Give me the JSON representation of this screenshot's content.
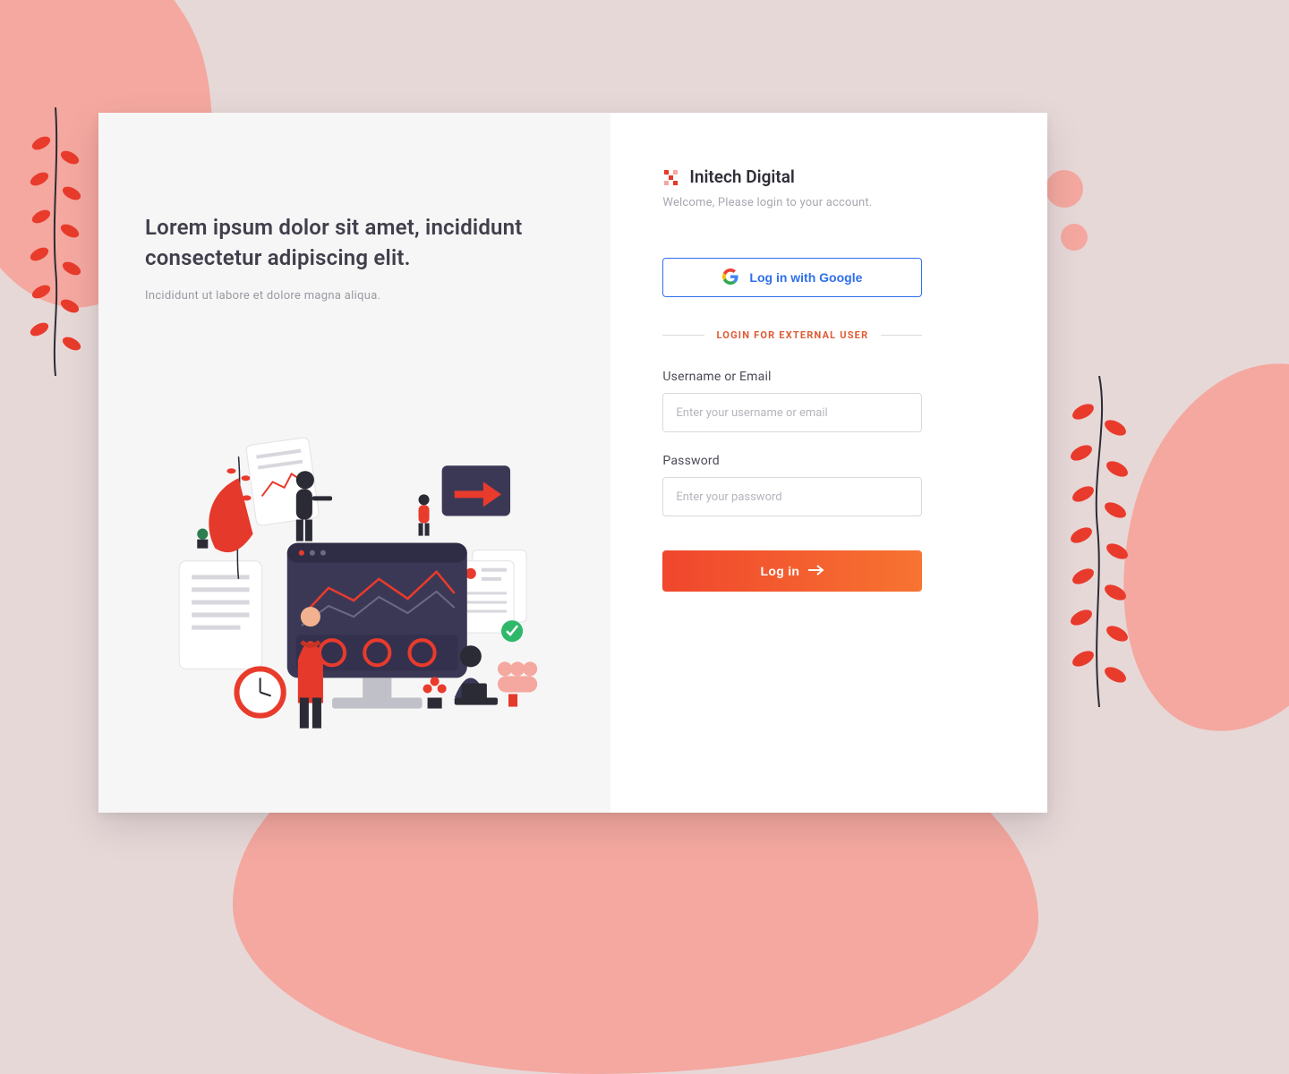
{
  "brand": {
    "name": "Initech Digital"
  },
  "hero": {
    "title": "Lorem ipsum dolor sit amet, incididunt consectetur adipiscing elit.",
    "subtitle": "Incididunt ut labore et dolore magna aliqua."
  },
  "login": {
    "welcome": "Welcome, Please login to your account.",
    "google_button": "Log in with Google",
    "divider_label": "LOGIN FOR EXTERNAL USER",
    "username_label": "Username or Email",
    "username_placeholder": "Enter your username or email",
    "password_label": "Password",
    "password_placeholder": "Enter your password",
    "submit_label": "Log in"
  }
}
